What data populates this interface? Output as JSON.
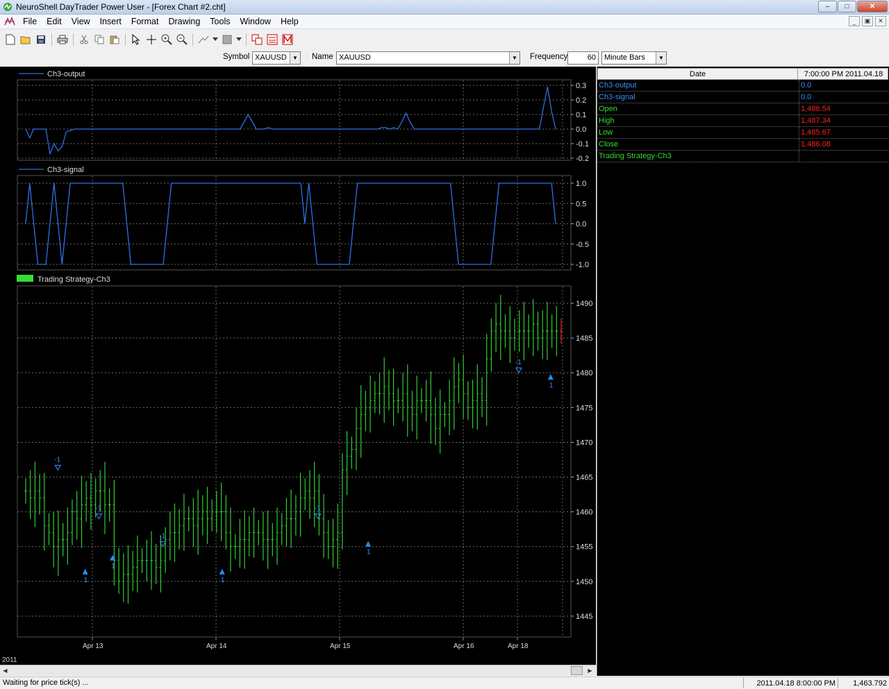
{
  "window": {
    "title": "NeuroShell DayTrader Power User - [Forex Chart #2.cht]",
    "buttons": {
      "minimize": "–",
      "restore": "□",
      "close": "✕"
    }
  },
  "menu": [
    "File",
    "Edit",
    "View",
    "Insert",
    "Format",
    "Drawing",
    "Tools",
    "Window",
    "Help"
  ],
  "symbolbar": {
    "symbol_label": "Symbol",
    "symbol_value": "XAUUSD",
    "name_label": "Name",
    "name_value": "XAUUSD",
    "frequency_label": "Frequency",
    "frequency_value": "60",
    "unit_value": "Minute Bars"
  },
  "colors": {
    "line": "#2f6fe0",
    "bar": "#33cc33",
    "signal": "#1e90ff",
    "grid": "#6a6a6a",
    "panel_text": "#dddddd",
    "red_value": "#ff2020"
  },
  "chart_data": [
    {
      "type": "line",
      "title": "Ch3-output",
      "yticks": [
        "0.3",
        "0.2",
        "0.1",
        "0.0",
        "-0.1",
        "-0.2"
      ],
      "ylim": [
        -0.2,
        0.3
      ],
      "series": [
        {
          "name": "Ch3-output",
          "values": [
            0.0,
            -0.06,
            0.0,
            0.0,
            0.0,
            0.0,
            -0.17,
            -0.1,
            -0.15,
            -0.12,
            -0.02,
            -0.01,
            0.0,
            0.0,
            0.0,
            0.0,
            0.0,
            0.0,
            0.0,
            0.0,
            0.0,
            0.0,
            0.0,
            0.0,
            0.0,
            0.0,
            0.0,
            0.0,
            0.0,
            0.0,
            0.0,
            0.0,
            0.0,
            0.0,
            0.0,
            0.0,
            0.0,
            0.0,
            0.0,
            0.0,
            0.0,
            0.0,
            0.0,
            0.0,
            0.0,
            0.0,
            0.0,
            0.0,
            0.0,
            0.0,
            0.0,
            0.0,
            0.0,
            0.0,
            0.05,
            0.1,
            0.05,
            0.0,
            0.0,
            0.0,
            0.01,
            0.0,
            0.0,
            0.0,
            0.0,
            0.0,
            0.0,
            0.0,
            0.0,
            0.0,
            0.0,
            0.0,
            0.0,
            0.0,
            0.0,
            0.0,
            0.0,
            0.0,
            0.0,
            0.0,
            0.0,
            0.0,
            0.0,
            0.0,
            0.0,
            0.0,
            0.0,
            0.0,
            0.01,
            0.01,
            0.0,
            0.01,
            0.0,
            0.05,
            0.11,
            0.05,
            0.0,
            0.0,
            0.0,
            0.0,
            0.0,
            0.0,
            0.0,
            0.0,
            0.0,
            0.0,
            0.0,
            0.0,
            0.0,
            0.0,
            0.0,
            0.0,
            0.0,
            0.0,
            0.0,
            0.0,
            0.0,
            0.0,
            0.0,
            0.0,
            0.0,
            0.0,
            0.0,
            0.0,
            0.0,
            0.0,
            0.0,
            0.0,
            0.15,
            0.29,
            0.12,
            0.0
          ]
        }
      ]
    },
    {
      "type": "line",
      "title": "Ch3-signal",
      "yticks": [
        "1.0",
        "0.5",
        "0.0",
        "-0.5",
        "-1.0"
      ],
      "ylim": [
        -1.0,
        1.0
      ],
      "series": [
        {
          "name": "Ch3-signal",
          "values": [
            0,
            1,
            0,
            -1,
            -1,
            -1,
            0,
            1,
            0,
            -1,
            0,
            1,
            1,
            1,
            1,
            1,
            1,
            1,
            1,
            1,
            1,
            1,
            1,
            1,
            1,
            0,
            -1,
            -1,
            -1,
            -1,
            -1,
            -1,
            -1,
            -1,
            -1,
            0,
            1,
            1,
            1,
            1,
            1,
            1,
            1,
            1,
            1,
            1,
            1,
            1,
            1,
            1,
            1,
            1,
            1,
            1,
            1,
            1,
            1,
            1,
            1,
            1,
            1,
            1,
            1,
            1,
            1,
            1,
            1,
            1,
            1,
            0,
            1,
            0,
            -1,
            -1,
            -1,
            -1,
            -1,
            -1,
            -1,
            -1,
            -1,
            0,
            1,
            1,
            1,
            1,
            1,
            1,
            1,
            1,
            1,
            1,
            1,
            1,
            1,
            1,
            1,
            1,
            1,
            1,
            1,
            1,
            1,
            1,
            1,
            1,
            0,
            -1,
            -1,
            -1,
            -1,
            -1,
            -1,
            -1,
            -1,
            -1,
            0,
            1,
            1,
            1,
            1,
            1,
            1,
            1,
            1,
            1,
            1,
            1,
            1,
            1,
            1,
            0
          ]
        }
      ]
    },
    {
      "type": "bar",
      "title": "Trading Strategy-Ch3",
      "yticks": [
        "1490",
        "1485",
        "1480",
        "1475",
        "1470",
        "1465",
        "1460",
        "1455",
        "1450",
        "1445"
      ],
      "ylim": [
        1442,
        1492.5
      ],
      "xticks": [
        "Apr 13",
        "Apr 14",
        "Apr 15",
        "Apr 16",
        "Apr 18"
      ],
      "x_year": "2011",
      "close": [
        1463,
        1462,
        1463,
        1462,
        1458,
        1457,
        1455,
        1456,
        1456,
        1457,
        1460,
        1459,
        1461,
        1462,
        1461,
        1463,
        1463,
        1461,
        1461,
        1453,
        1450,
        1451,
        1451,
        1452,
        1453,
        1453,
        1453,
        1453,
        1452,
        1453,
        1456,
        1457,
        1457,
        1458,
        1459,
        1459,
        1458,
        1459,
        1460,
        1459,
        1460,
        1460,
        1460,
        1457,
        1455,
        1455,
        1456,
        1456,
        1457,
        1457,
        1457,
        1456,
        1456,
        1456,
        1457,
        1458,
        1459,
        1459,
        1460,
        1462,
        1463,
        1462,
        1463,
        1459,
        1457,
        1455,
        1456,
        1457,
        1466,
        1468,
        1469,
        1472,
        1474,
        1475,
        1476,
        1477,
        1477,
        1478,
        1477,
        1476,
        1476,
        1477,
        1475,
        1474,
        1476,
        1476,
        1476,
        1474,
        1472,
        1474,
        1474,
        1476,
        1478,
        1479,
        1477,
        1475,
        1476,
        1477,
        1476,
        1482,
        1486,
        1487,
        1486,
        1486,
        1485,
        1486,
        1486,
        1486,
        1486,
        1487,
        1485,
        1486,
        1486,
        1486,
        1486,
        1486
      ],
      "signals": [
        {
          "kind": "sell",
          "label": "-1",
          "value": "1466"
        },
        {
          "kind": "buy",
          "label": "1",
          "value": "1451"
        },
        {
          "kind": "sell",
          "label": "-1",
          "value": "1459"
        },
        {
          "kind": "buy",
          "label": "1",
          "value": "1453"
        },
        {
          "kind": "sell",
          "label": "-1",
          "value": "1455"
        },
        {
          "kind": "buy",
          "label": "1",
          "value": "1451"
        },
        {
          "kind": "sell",
          "label": "-1",
          "value": "1459"
        },
        {
          "kind": "buy",
          "label": "1",
          "value": "1455"
        },
        {
          "kind": "sell",
          "label": "-1",
          "value": "1480"
        },
        {
          "kind": "buy",
          "label": "1",
          "value": "1479"
        }
      ]
    }
  ],
  "data_panel": {
    "header_left": "Date",
    "header_right": "7:00:00 PM 2011.04.18",
    "rows": [
      {
        "label": "Ch3-output",
        "value": "0.0",
        "label_color": "#3a8fff",
        "value_color": "#3a8fff"
      },
      {
        "label": "Ch3-signal",
        "value": "0.0",
        "label_color": "#3a8fff",
        "value_color": "#3a8fff"
      },
      {
        "label": "Open",
        "value": "1,486.54",
        "label_color": "#33dd33",
        "value_color": "#ff2020"
      },
      {
        "label": "High",
        "value": "1,487.34",
        "label_color": "#33dd33",
        "value_color": "#ff2020"
      },
      {
        "label": "Low",
        "value": "1,485.67",
        "label_color": "#33dd33",
        "value_color": "#ff2020"
      },
      {
        "label": "Close",
        "value": "1,486.08",
        "label_color": "#33dd33",
        "value_color": "#ff2020"
      },
      {
        "label": "Trading Strategy-Ch3",
        "value": "",
        "label_color": "#33dd33",
        "value_color": "#ff2020"
      }
    ]
  },
  "status": {
    "text": "Waiting for price tick(s) ...",
    "datetime": "2011.04.18 8:00:00 PM",
    "value": "1,463.792"
  }
}
